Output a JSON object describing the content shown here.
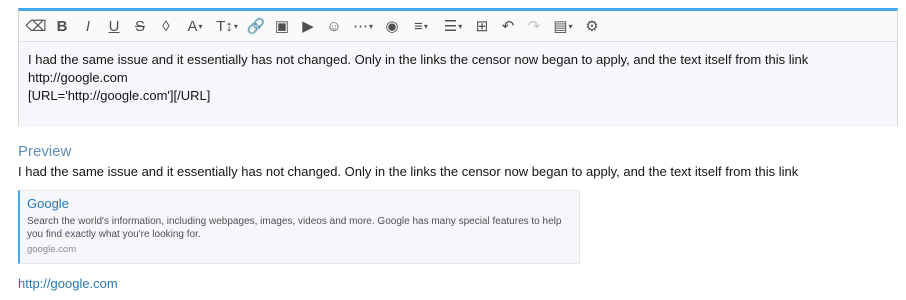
{
  "editor": {
    "toolbar": [
      {
        "name": "remove-format-icon",
        "glyph": "⌫",
        "disabled": false
      },
      {
        "name": "bold-icon",
        "glyph": "B",
        "disabled": false
      },
      {
        "name": "italic-icon",
        "glyph": "I",
        "disabled": false
      },
      {
        "name": "underline-icon",
        "glyph": "U",
        "disabled": false
      },
      {
        "name": "strikethrough-icon",
        "glyph": "S",
        "disabled": false
      },
      {
        "name": "color-drop-icon",
        "glyph": "◊",
        "disabled": false
      },
      {
        "name": "font-family-icon",
        "glyph": "A",
        "caret": true,
        "disabled": false
      },
      {
        "name": "font-size-icon",
        "glyph": "T↕",
        "caret": true,
        "disabled": false
      },
      {
        "name": "link-icon",
        "glyph": "🔗",
        "disabled": false
      },
      {
        "name": "image-icon",
        "glyph": "▣",
        "disabled": false
      },
      {
        "name": "media-icon",
        "glyph": "▶",
        "disabled": false
      },
      {
        "name": "emoji-icon",
        "glyph": "☺",
        "disabled": false
      },
      {
        "name": "more-icon",
        "glyph": "⋯",
        "caret": true,
        "disabled": false
      },
      {
        "name": "camera-icon",
        "glyph": "◉",
        "disabled": false
      },
      {
        "name": "align-icon",
        "glyph": "≡",
        "caret": true,
        "disabled": false
      },
      {
        "name": "list-icon",
        "glyph": "☰",
        "caret": true,
        "disabled": false
      },
      {
        "name": "table-icon",
        "glyph": "⊞",
        "disabled": false
      },
      {
        "name": "undo-icon",
        "glyph": "↶",
        "disabled": false
      },
      {
        "name": "redo-icon",
        "glyph": "↷",
        "disabled": true
      },
      {
        "name": "drafts-icon",
        "glyph": "▤",
        "caret": true,
        "disabled": false
      },
      {
        "name": "settings-icon",
        "glyph": "⚙",
        "disabled": false
      }
    ],
    "content_lines": [
      "I had the same issue and it essentially has not changed. Only in the links the censor now began to apply, and the text itself from this link",
      "http://google.com",
      "[URL='http://google.com'][/URL]"
    ]
  },
  "preview": {
    "title": "Preview",
    "text": "I had the same issue and it essentially has not changed. Only in the links the censor now began to apply, and the text itself from this link",
    "unfurl": {
      "title": "Google",
      "description": "Search the world's information, including webpages, images, videos and more. Google has many special features to help you find exactly what you're looking for.",
      "domain": "google.com"
    },
    "link": "http://google.com"
  }
}
